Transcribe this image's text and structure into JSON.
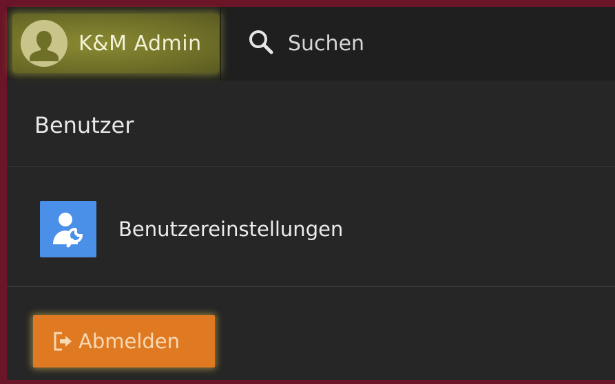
{
  "header": {
    "user_name": "K&M Admin",
    "search_label": "Suchen"
  },
  "menu": {
    "section_title": "Benutzer",
    "settings_label": "Benutzereinstellungen",
    "logout_label": "Abmelden"
  },
  "icons": {
    "avatar": "user-avatar-icon",
    "search": "search-icon",
    "settings": "user-settings-icon",
    "logout": "logout-icon"
  },
  "colors": {
    "frame": "#6a1528",
    "user_highlight": "#6f7028",
    "settings_icon_bg": "#4a8fe8",
    "logout_button": "#e07a22"
  }
}
